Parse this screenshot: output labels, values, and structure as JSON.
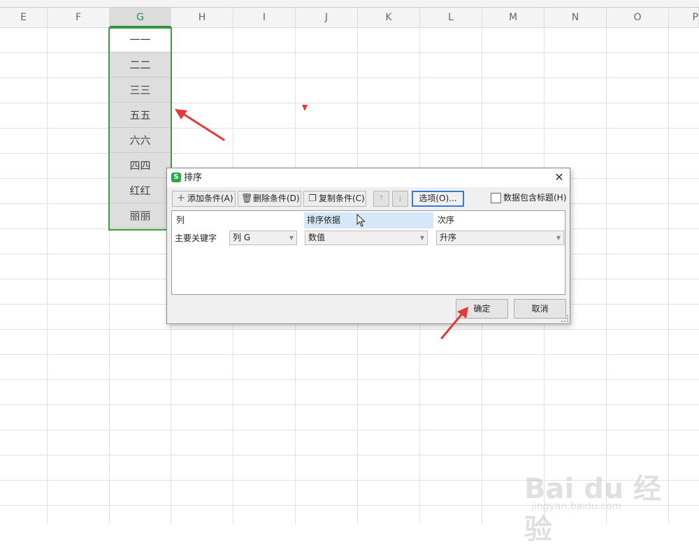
{
  "sheet": {
    "columns": [
      "E",
      "F",
      "G",
      "H",
      "I",
      "J",
      "K",
      "L",
      "M",
      "N",
      "O",
      "P"
    ],
    "active_column": "G",
    "cells": [
      "一一",
      "二二",
      "三三",
      "五五",
      "六六",
      "四四",
      "红红",
      "丽丽"
    ]
  },
  "dialog": {
    "title": "排序",
    "app_icon": "S",
    "toolbar": {
      "add_condition": "添加条件(A)",
      "delete_condition": "删除条件(D)",
      "copy_condition": "复制条件(C)",
      "move_up": "↑",
      "move_down": "↓",
      "options": "选项(O)...",
      "header_checkbox": "数据包含标题(H)"
    },
    "columns": {
      "column": "列",
      "basis": "排序依据",
      "order": "次序"
    },
    "row": {
      "label": "主要关键字",
      "column_value": "列 G",
      "basis_value": "数值",
      "order_value": "升序"
    },
    "buttons": {
      "ok": "确定",
      "cancel": "取消"
    }
  },
  "watermark": {
    "logo": "Bai du 经验",
    "url": "jingyan.baidu.com"
  },
  "colors": {
    "selection": "#3a9e3f",
    "annotation": "#e53935",
    "options_border": "#3a78d6",
    "header_highlight": "#d6e7f7"
  }
}
